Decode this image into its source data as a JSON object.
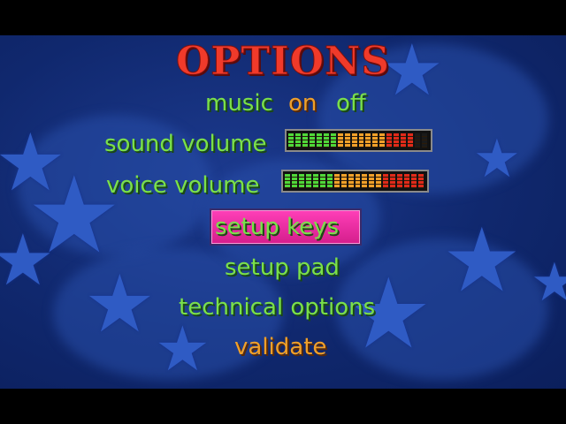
{
  "menu": {
    "title": "OPTIONS",
    "music": {
      "label": "music",
      "on_label": "on",
      "off_label": "off",
      "selected": "on"
    },
    "sound_volume": {
      "label": "sound volume",
      "level": 0.92
    },
    "voice_volume": {
      "label": "voice volume",
      "level": 1.0
    },
    "setup_keys": "setup keys",
    "setup_pad": "setup pad",
    "technical_options": "technical options",
    "validate": "validate",
    "highlighted": "setup keys"
  },
  "colors": {
    "title": "#f03a2a",
    "item_default": "#7be04a",
    "item_selected": "#f0a02a",
    "highlight": "#ff3fb8",
    "background": "#10286e"
  }
}
